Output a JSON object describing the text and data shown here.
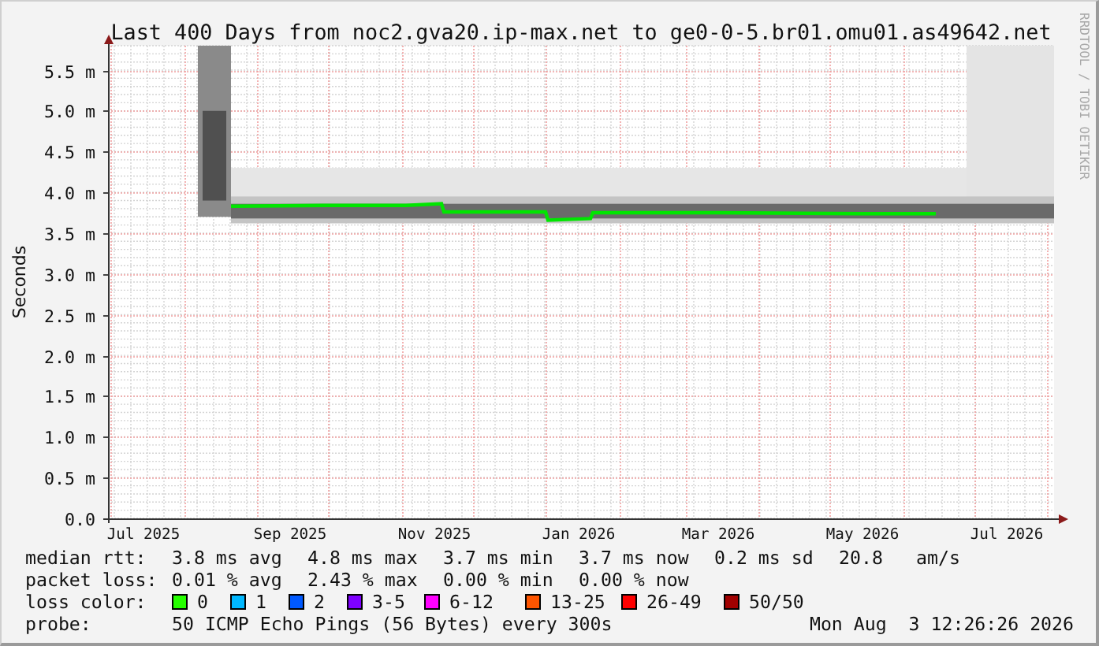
{
  "graph": {
    "side_label": "RRDTOOL / TOBI OETIKER",
    "chart_data": {
      "type": "line",
      "title": "Last 400 Days from noc2.gva20.ip-max.net to ge0-0-5.br01.omu01.as49642.net",
      "ylabel": "Seconds",
      "xlim": [
        "2025-06-16",
        "2026-07-21"
      ],
      "ylim": [
        0,
        5.8
      ],
      "grid": true,
      "xticks": [
        {
          "value": "2025-07-01",
          "label": "Jul 2025"
        },
        {
          "value": "2025-09-01",
          "label": "Sep 2025"
        },
        {
          "value": "2025-11-01",
          "label": "Nov 2025"
        },
        {
          "value": "2026-01-01",
          "label": "Jan 2026"
        },
        {
          "value": "2026-03-01",
          "label": "Mar 2026"
        },
        {
          "value": "2026-05-01",
          "label": "May 2026"
        },
        {
          "value": "2026-07-01",
          "label": "Jul 2026"
        }
      ],
      "yticks": [
        {
          "value": 0,
          "label": "0.0"
        },
        {
          "value": 0.5,
          "label": "0.5 m"
        },
        {
          "value": 1,
          "label": "1.0 m"
        },
        {
          "value": 1.5,
          "label": "1.5 m"
        },
        {
          "value": 2,
          "label": "2.0 m"
        },
        {
          "value": 2.5,
          "label": "2.5 m"
        },
        {
          "value": 3,
          "label": "3.0 m"
        },
        {
          "value": 3.5,
          "label": "3.5 m"
        },
        {
          "value": 4,
          "label": "4.0 m"
        },
        {
          "value": 4.5,
          "label": "4.5 m"
        },
        {
          "value": 5,
          "label": "5.0 m"
        },
        {
          "value": 5.5,
          "label": "5.5 m"
        }
      ],
      "x": [
        "2025-08-07",
        "2025-09-15",
        "2025-10-20",
        "2025-11-04",
        "2025-11-05",
        "2025-12-18",
        "2025-12-19",
        "2026-01-06",
        "2026-01-07",
        "2026-03-01",
        "2026-05-01",
        "2026-06-01"
      ],
      "series": [
        {
          "color": "#00e600",
          "values": [
            3.83,
            3.84,
            3.84,
            3.86,
            3.76,
            3.76,
            3.66,
            3.68,
            3.75,
            3.75,
            3.74,
            3.74
          ]
        }
      ]
    }
  },
  "legend": {
    "median_rtt": {
      "label": "median rtt:",
      "values": [
        "3.8 ms avg",
        "4.8 ms max",
        "3.7 ms min",
        "3.7 ms now",
        "0.2 ms sd",
        "20.8",
        "am/s"
      ]
    },
    "packet_loss": {
      "label": "packet loss:",
      "values": [
        "0.01 % avg",
        "2.43 % max",
        "0.00 % min",
        "0.00 % now"
      ]
    },
    "loss_color": {
      "label": "loss color:",
      "items": [
        {
          "label": "0",
          "color": "#26ff00"
        },
        {
          "label": "1",
          "color": "#00b8ff"
        },
        {
          "label": "2",
          "color": "#0059ff"
        },
        {
          "label": "3-5",
          "color": "#7e00ff"
        },
        {
          "label": "6-12",
          "color": "#ff00ff"
        },
        {
          "label": "13-25",
          "color": "#ff5500"
        },
        {
          "label": "26-49",
          "color": "#ff0000"
        },
        {
          "label": "50/50",
          "color": "#a10000"
        }
      ]
    },
    "probe": {
      "label": "probe:",
      "text": "50 ICMP Echo Pings (56 Bytes) every 300s",
      "timestamp": "Mon Aug  3 12:26:26 2026"
    }
  }
}
